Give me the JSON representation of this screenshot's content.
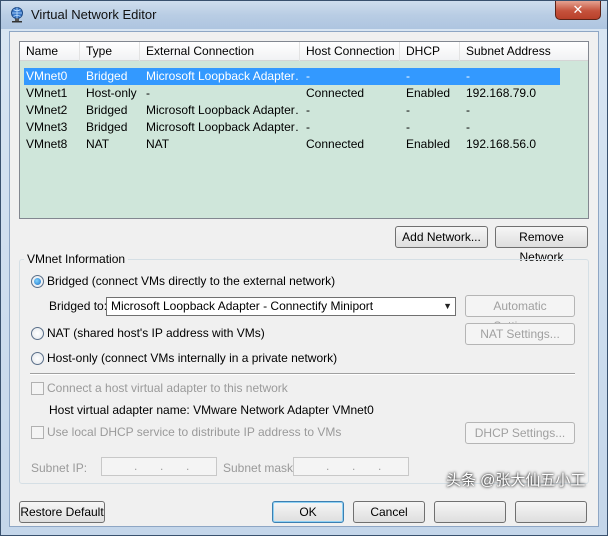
{
  "window": {
    "title": "Virtual Network Editor",
    "close_glyph": "✕"
  },
  "table": {
    "columns": [
      "Name",
      "Type",
      "External Connection",
      "Host Connection",
      "DHCP",
      "Subnet Address"
    ],
    "rows": [
      [
        "VMnet0",
        "Bridged",
        "Microsoft Loopback Adapter…",
        "-",
        "-",
        "-"
      ],
      [
        "VMnet1",
        "Host-only",
        "-",
        "Connected",
        "Enabled",
        "192.168.79.0"
      ],
      [
        "VMnet2",
        "Bridged",
        "Microsoft Loopback Adapter…",
        "-",
        "-",
        "-"
      ],
      [
        "VMnet3",
        "Bridged",
        "Microsoft Loopback Adapter…",
        "-",
        "-",
        "-"
      ],
      [
        "VMnet8",
        "NAT",
        "NAT",
        "Connected",
        "Enabled",
        "192.168.56.0"
      ]
    ],
    "selected_row": 0
  },
  "network_buttons": {
    "add": "Add Network...",
    "remove": "Remove Network"
  },
  "info": {
    "group_title": "VMnet Information",
    "bridged_label": "Bridged (connect VMs directly to the external network)",
    "bridged_to_label": "Bridged to:",
    "bridged_to_value": "Microsoft Loopback Adapter - Connectify Miniport",
    "automatic_settings": "Automatic Settings...",
    "nat_label": "NAT (shared host's IP address with VMs)",
    "nat_settings": "NAT Settings...",
    "hostonly_label": "Host-only (connect VMs internally in a private network)",
    "connect_adapter_label": "Connect a host virtual adapter to this network",
    "adapter_name_label": "Host virtual adapter name: VMware Network Adapter VMnet0",
    "dhcp_label": "Use local DHCP service to distribute IP address to VMs",
    "dhcp_settings": "DHCP Settings...",
    "subnet_ip_label": "Subnet IP:",
    "subnet_mask_label": "Subnet mask:",
    "selected_mode": "bridged"
  },
  "footer": {
    "restore": "Restore Default",
    "ok": "OK",
    "cancel": "Cancel"
  },
  "watermark": "头条 @张大仙五小工",
  "colors": {
    "selection": "#3399ff",
    "list_background": "#cfe6da"
  }
}
